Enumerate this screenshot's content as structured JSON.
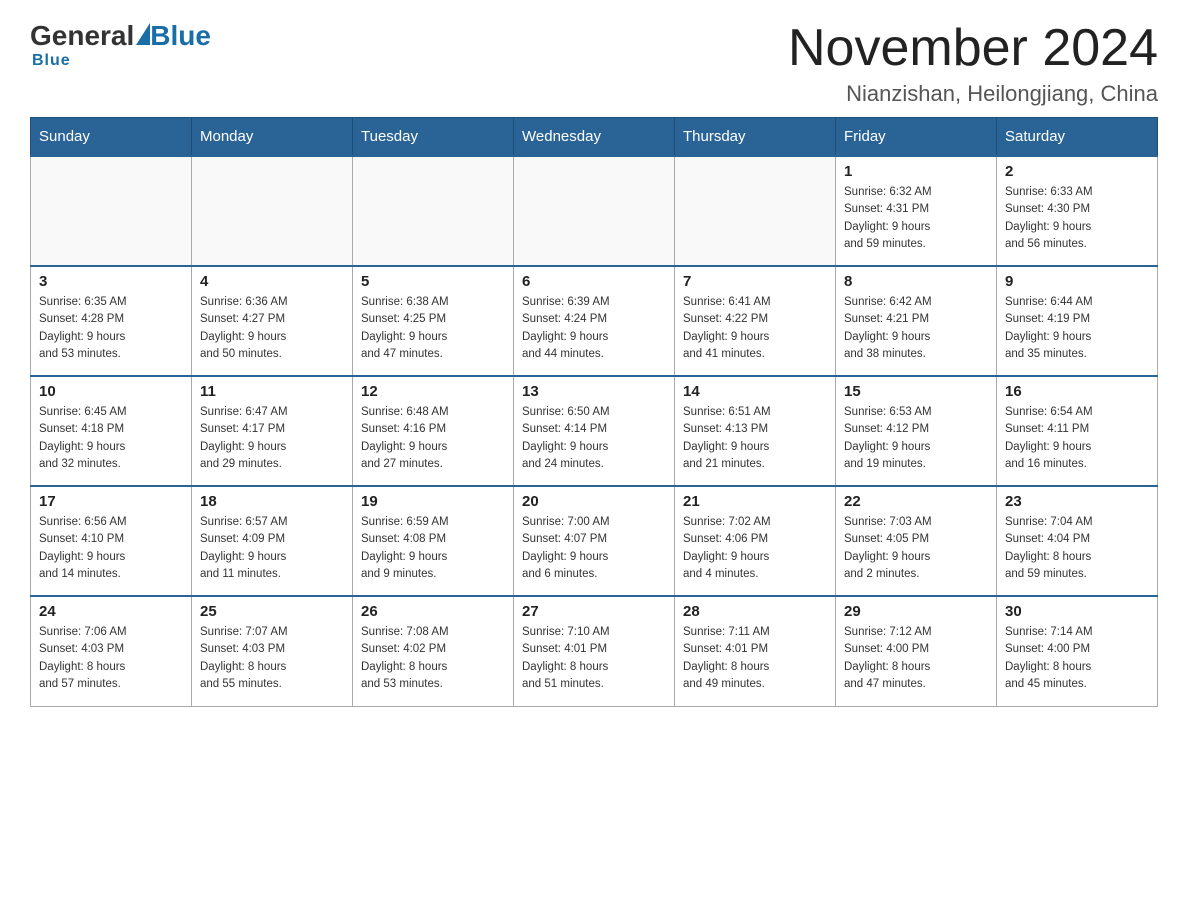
{
  "header": {
    "logo_general": "General",
    "logo_blue": "Blue",
    "month_title": "November 2024",
    "location": "Nianzishan, Heilongjiang, China"
  },
  "days_of_week": [
    "Sunday",
    "Monday",
    "Tuesday",
    "Wednesday",
    "Thursday",
    "Friday",
    "Saturday"
  ],
  "weeks": [
    [
      {
        "day": "",
        "info": ""
      },
      {
        "day": "",
        "info": ""
      },
      {
        "day": "",
        "info": ""
      },
      {
        "day": "",
        "info": ""
      },
      {
        "day": "",
        "info": ""
      },
      {
        "day": "1",
        "info": "Sunrise: 6:32 AM\nSunset: 4:31 PM\nDaylight: 9 hours\nand 59 minutes."
      },
      {
        "day": "2",
        "info": "Sunrise: 6:33 AM\nSunset: 4:30 PM\nDaylight: 9 hours\nand 56 minutes."
      }
    ],
    [
      {
        "day": "3",
        "info": "Sunrise: 6:35 AM\nSunset: 4:28 PM\nDaylight: 9 hours\nand 53 minutes."
      },
      {
        "day": "4",
        "info": "Sunrise: 6:36 AM\nSunset: 4:27 PM\nDaylight: 9 hours\nand 50 minutes."
      },
      {
        "day": "5",
        "info": "Sunrise: 6:38 AM\nSunset: 4:25 PM\nDaylight: 9 hours\nand 47 minutes."
      },
      {
        "day": "6",
        "info": "Sunrise: 6:39 AM\nSunset: 4:24 PM\nDaylight: 9 hours\nand 44 minutes."
      },
      {
        "day": "7",
        "info": "Sunrise: 6:41 AM\nSunset: 4:22 PM\nDaylight: 9 hours\nand 41 minutes."
      },
      {
        "day": "8",
        "info": "Sunrise: 6:42 AM\nSunset: 4:21 PM\nDaylight: 9 hours\nand 38 minutes."
      },
      {
        "day": "9",
        "info": "Sunrise: 6:44 AM\nSunset: 4:19 PM\nDaylight: 9 hours\nand 35 minutes."
      }
    ],
    [
      {
        "day": "10",
        "info": "Sunrise: 6:45 AM\nSunset: 4:18 PM\nDaylight: 9 hours\nand 32 minutes."
      },
      {
        "day": "11",
        "info": "Sunrise: 6:47 AM\nSunset: 4:17 PM\nDaylight: 9 hours\nand 29 minutes."
      },
      {
        "day": "12",
        "info": "Sunrise: 6:48 AM\nSunset: 4:16 PM\nDaylight: 9 hours\nand 27 minutes."
      },
      {
        "day": "13",
        "info": "Sunrise: 6:50 AM\nSunset: 4:14 PM\nDaylight: 9 hours\nand 24 minutes."
      },
      {
        "day": "14",
        "info": "Sunrise: 6:51 AM\nSunset: 4:13 PM\nDaylight: 9 hours\nand 21 minutes."
      },
      {
        "day": "15",
        "info": "Sunrise: 6:53 AM\nSunset: 4:12 PM\nDaylight: 9 hours\nand 19 minutes."
      },
      {
        "day": "16",
        "info": "Sunrise: 6:54 AM\nSunset: 4:11 PM\nDaylight: 9 hours\nand 16 minutes."
      }
    ],
    [
      {
        "day": "17",
        "info": "Sunrise: 6:56 AM\nSunset: 4:10 PM\nDaylight: 9 hours\nand 14 minutes."
      },
      {
        "day": "18",
        "info": "Sunrise: 6:57 AM\nSunset: 4:09 PM\nDaylight: 9 hours\nand 11 minutes."
      },
      {
        "day": "19",
        "info": "Sunrise: 6:59 AM\nSunset: 4:08 PM\nDaylight: 9 hours\nand 9 minutes."
      },
      {
        "day": "20",
        "info": "Sunrise: 7:00 AM\nSunset: 4:07 PM\nDaylight: 9 hours\nand 6 minutes."
      },
      {
        "day": "21",
        "info": "Sunrise: 7:02 AM\nSunset: 4:06 PM\nDaylight: 9 hours\nand 4 minutes."
      },
      {
        "day": "22",
        "info": "Sunrise: 7:03 AM\nSunset: 4:05 PM\nDaylight: 9 hours\nand 2 minutes."
      },
      {
        "day": "23",
        "info": "Sunrise: 7:04 AM\nSunset: 4:04 PM\nDaylight: 8 hours\nand 59 minutes."
      }
    ],
    [
      {
        "day": "24",
        "info": "Sunrise: 7:06 AM\nSunset: 4:03 PM\nDaylight: 8 hours\nand 57 minutes."
      },
      {
        "day": "25",
        "info": "Sunrise: 7:07 AM\nSunset: 4:03 PM\nDaylight: 8 hours\nand 55 minutes."
      },
      {
        "day": "26",
        "info": "Sunrise: 7:08 AM\nSunset: 4:02 PM\nDaylight: 8 hours\nand 53 minutes."
      },
      {
        "day": "27",
        "info": "Sunrise: 7:10 AM\nSunset: 4:01 PM\nDaylight: 8 hours\nand 51 minutes."
      },
      {
        "day": "28",
        "info": "Sunrise: 7:11 AM\nSunset: 4:01 PM\nDaylight: 8 hours\nand 49 minutes."
      },
      {
        "day": "29",
        "info": "Sunrise: 7:12 AM\nSunset: 4:00 PM\nDaylight: 8 hours\nand 47 minutes."
      },
      {
        "day": "30",
        "info": "Sunrise: 7:14 AM\nSunset: 4:00 PM\nDaylight: 8 hours\nand 45 minutes."
      }
    ]
  ]
}
